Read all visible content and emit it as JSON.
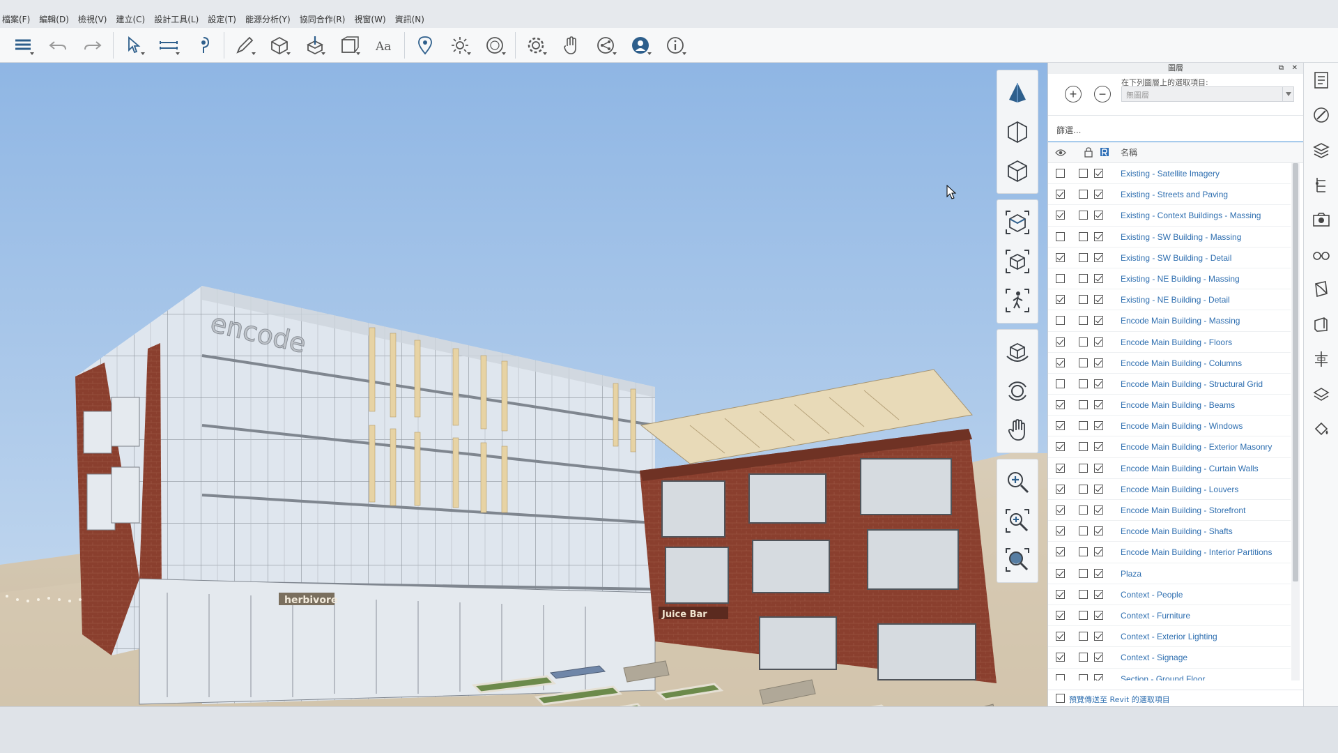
{
  "menu": [
    "檔案(F)",
    "編輯(D)",
    "檢視(V)",
    "建立(C)",
    "設計工具(L)",
    "設定(T)",
    "能源分析(Y)",
    "協同合作(R)",
    "視窗(W)",
    "資訊(N)"
  ],
  "toolbar_icons": [
    {
      "name": "layers-icon",
      "caret": true
    },
    {
      "name": "undo-icon",
      "caret": false
    },
    {
      "name": "redo-icon",
      "caret": false
    },
    {
      "sep": true
    },
    {
      "name": "select-icon",
      "caret": true
    },
    {
      "name": "measure-icon",
      "caret": true
    },
    {
      "name": "paint-icon",
      "caret": false
    },
    {
      "sep": true
    },
    {
      "name": "sketch-icon",
      "caret": true
    },
    {
      "name": "box-icon",
      "caret": true
    },
    {
      "name": "push-pull-icon",
      "caret": true
    },
    {
      "name": "transform-icon",
      "caret": true
    },
    {
      "name": "text-icon",
      "caret": false
    },
    {
      "sep": true
    },
    {
      "name": "location-icon",
      "caret": false
    },
    {
      "name": "sun-icon",
      "caret": true
    },
    {
      "name": "render-icon",
      "caret": true
    },
    {
      "sep": true
    },
    {
      "name": "settings-icon",
      "caret": true
    },
    {
      "name": "hand-gesture-icon",
      "caret": false
    },
    {
      "name": "share-icon",
      "caret": true
    },
    {
      "name": "account-icon",
      "caret": true
    },
    {
      "name": "info-icon",
      "caret": true
    }
  ],
  "viewport": {
    "sign_encode": "encode",
    "sign_herbivore": "herbivore",
    "sign_juice": "Juice Bar"
  },
  "layers_panel": {
    "title": "圖層",
    "selection_label": "在下列圖層上的選取項目:",
    "selection_value": "無圖層",
    "filter_placeholder": "篩選...",
    "name_header": "名稱",
    "footer_label": "預覽傳送至 Revit 的選取項目",
    "layers": [
      {
        "name": "Existing - Satellite Imagery",
        "visible": false,
        "locked": false,
        "revit": true
      },
      {
        "name": "Existing - Streets and Paving",
        "visible": true,
        "locked": false,
        "revit": true
      },
      {
        "name": "Existing - Context Buildings - Massing",
        "visible": true,
        "locked": false,
        "revit": true
      },
      {
        "name": "Existing - SW Building - Massing",
        "visible": false,
        "locked": false,
        "revit": true
      },
      {
        "name": "Existing - SW Building - Detail",
        "visible": true,
        "locked": false,
        "revit": true
      },
      {
        "name": "Existing - NE Building - Massing",
        "visible": false,
        "locked": false,
        "revit": true
      },
      {
        "name": "Existing - NE Building - Detail",
        "visible": true,
        "locked": false,
        "revit": true
      },
      {
        "name": "Encode Main Building - Massing",
        "visible": false,
        "locked": false,
        "revit": true
      },
      {
        "name": "Encode Main Building - Floors",
        "visible": true,
        "locked": false,
        "revit": true
      },
      {
        "name": "Encode Main Building - Columns",
        "visible": true,
        "locked": false,
        "revit": true
      },
      {
        "name": "Encode Main Building - Structural Grid",
        "visible": false,
        "locked": false,
        "revit": true
      },
      {
        "name": "Encode Main Building - Beams",
        "visible": true,
        "locked": false,
        "revit": true
      },
      {
        "name": "Encode Main Building - Windows",
        "visible": true,
        "locked": false,
        "revit": true
      },
      {
        "name": "Encode Main Building - Exterior Masonry",
        "visible": true,
        "locked": false,
        "revit": true
      },
      {
        "name": "Encode Main Building - Curtain Walls",
        "visible": true,
        "locked": false,
        "revit": true
      },
      {
        "name": "Encode Main Building - Louvers",
        "visible": true,
        "locked": false,
        "revit": true
      },
      {
        "name": "Encode Main Building - Storefront",
        "visible": true,
        "locked": false,
        "revit": true
      },
      {
        "name": "Encode Main Building - Shafts",
        "visible": true,
        "locked": false,
        "revit": true
      },
      {
        "name": "Encode Main Building - Interior Partitions",
        "visible": true,
        "locked": false,
        "revit": true
      },
      {
        "name": "Plaza",
        "visible": true,
        "locked": false,
        "revit": true
      },
      {
        "name": "Context - People",
        "visible": true,
        "locked": false,
        "revit": true
      },
      {
        "name": "Context - Furniture",
        "visible": true,
        "locked": false,
        "revit": true
      },
      {
        "name": "Context - Exterior Lighting",
        "visible": true,
        "locked": false,
        "revit": true
      },
      {
        "name": "Context - Signage",
        "visible": true,
        "locked": false,
        "revit": true
      },
      {
        "name": "Section - Ground Floor",
        "visible": false,
        "locked": false,
        "revit": true
      }
    ]
  },
  "colors": {
    "sky_top": "#8fb6e4",
    "sky_bottom": "#c3d8ee",
    "brick": "#8a3f2e",
    "layer_text": "#2f6fb0",
    "louver": "#e7d3a4"
  }
}
